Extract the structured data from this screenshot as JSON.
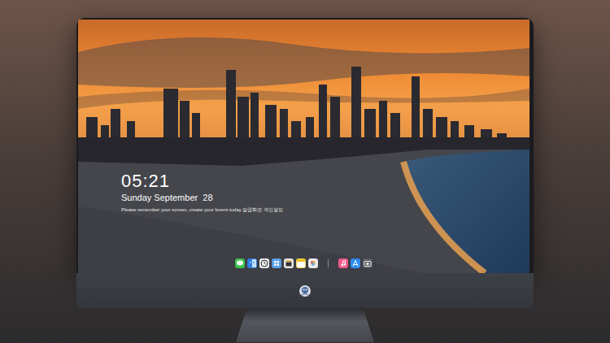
{
  "lock_screen": {
    "time": "05:21",
    "date": "Sunday September  28",
    "message": "Please remember your screen, create your lovers today 잠금화면 개인설정"
  }
}
